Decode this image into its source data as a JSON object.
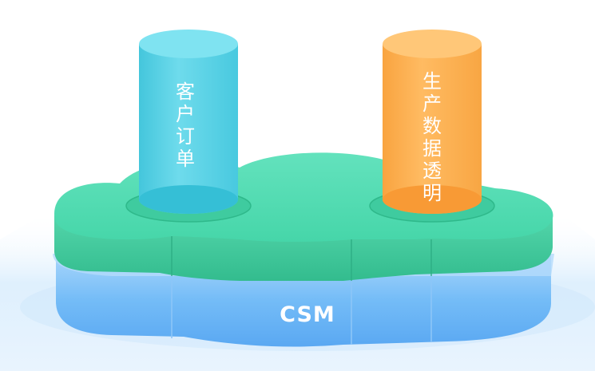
{
  "diagram": {
    "base_label": "CSM",
    "cylinders": [
      {
        "label": "客户订单",
        "color": "#55d3e6"
      },
      {
        "label": "生产数据透明",
        "color": "#ffb04e"
      }
    ],
    "colors": {
      "green_top": "#52dcb3",
      "green_side": "#35c496",
      "blue_side": "#6ab7f8",
      "glow": "#d4ebfd"
    }
  }
}
